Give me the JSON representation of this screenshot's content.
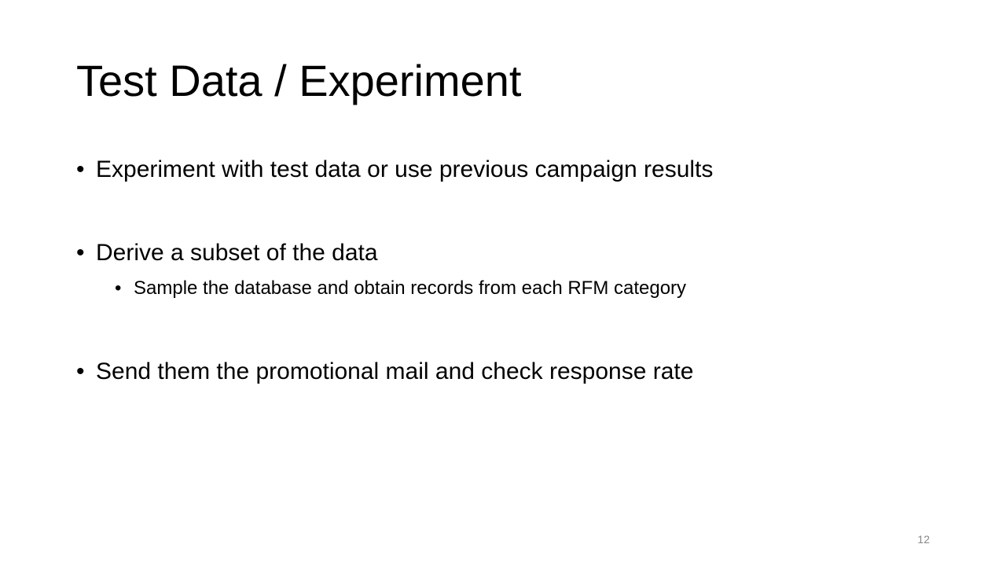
{
  "slide": {
    "title": "Test Data / Experiment",
    "bullet_glyph": "•",
    "bullets": [
      "Experiment with test data or use previous campaign results",
      "Derive a subset of the data",
      "Sample the database and obtain records from each RFM category",
      "Send them the promotional mail and check response rate"
    ],
    "slide_number": "12"
  },
  "colors": {
    "text": "#000000",
    "slide_number": "#888888",
    "background": "#ffffff"
  }
}
